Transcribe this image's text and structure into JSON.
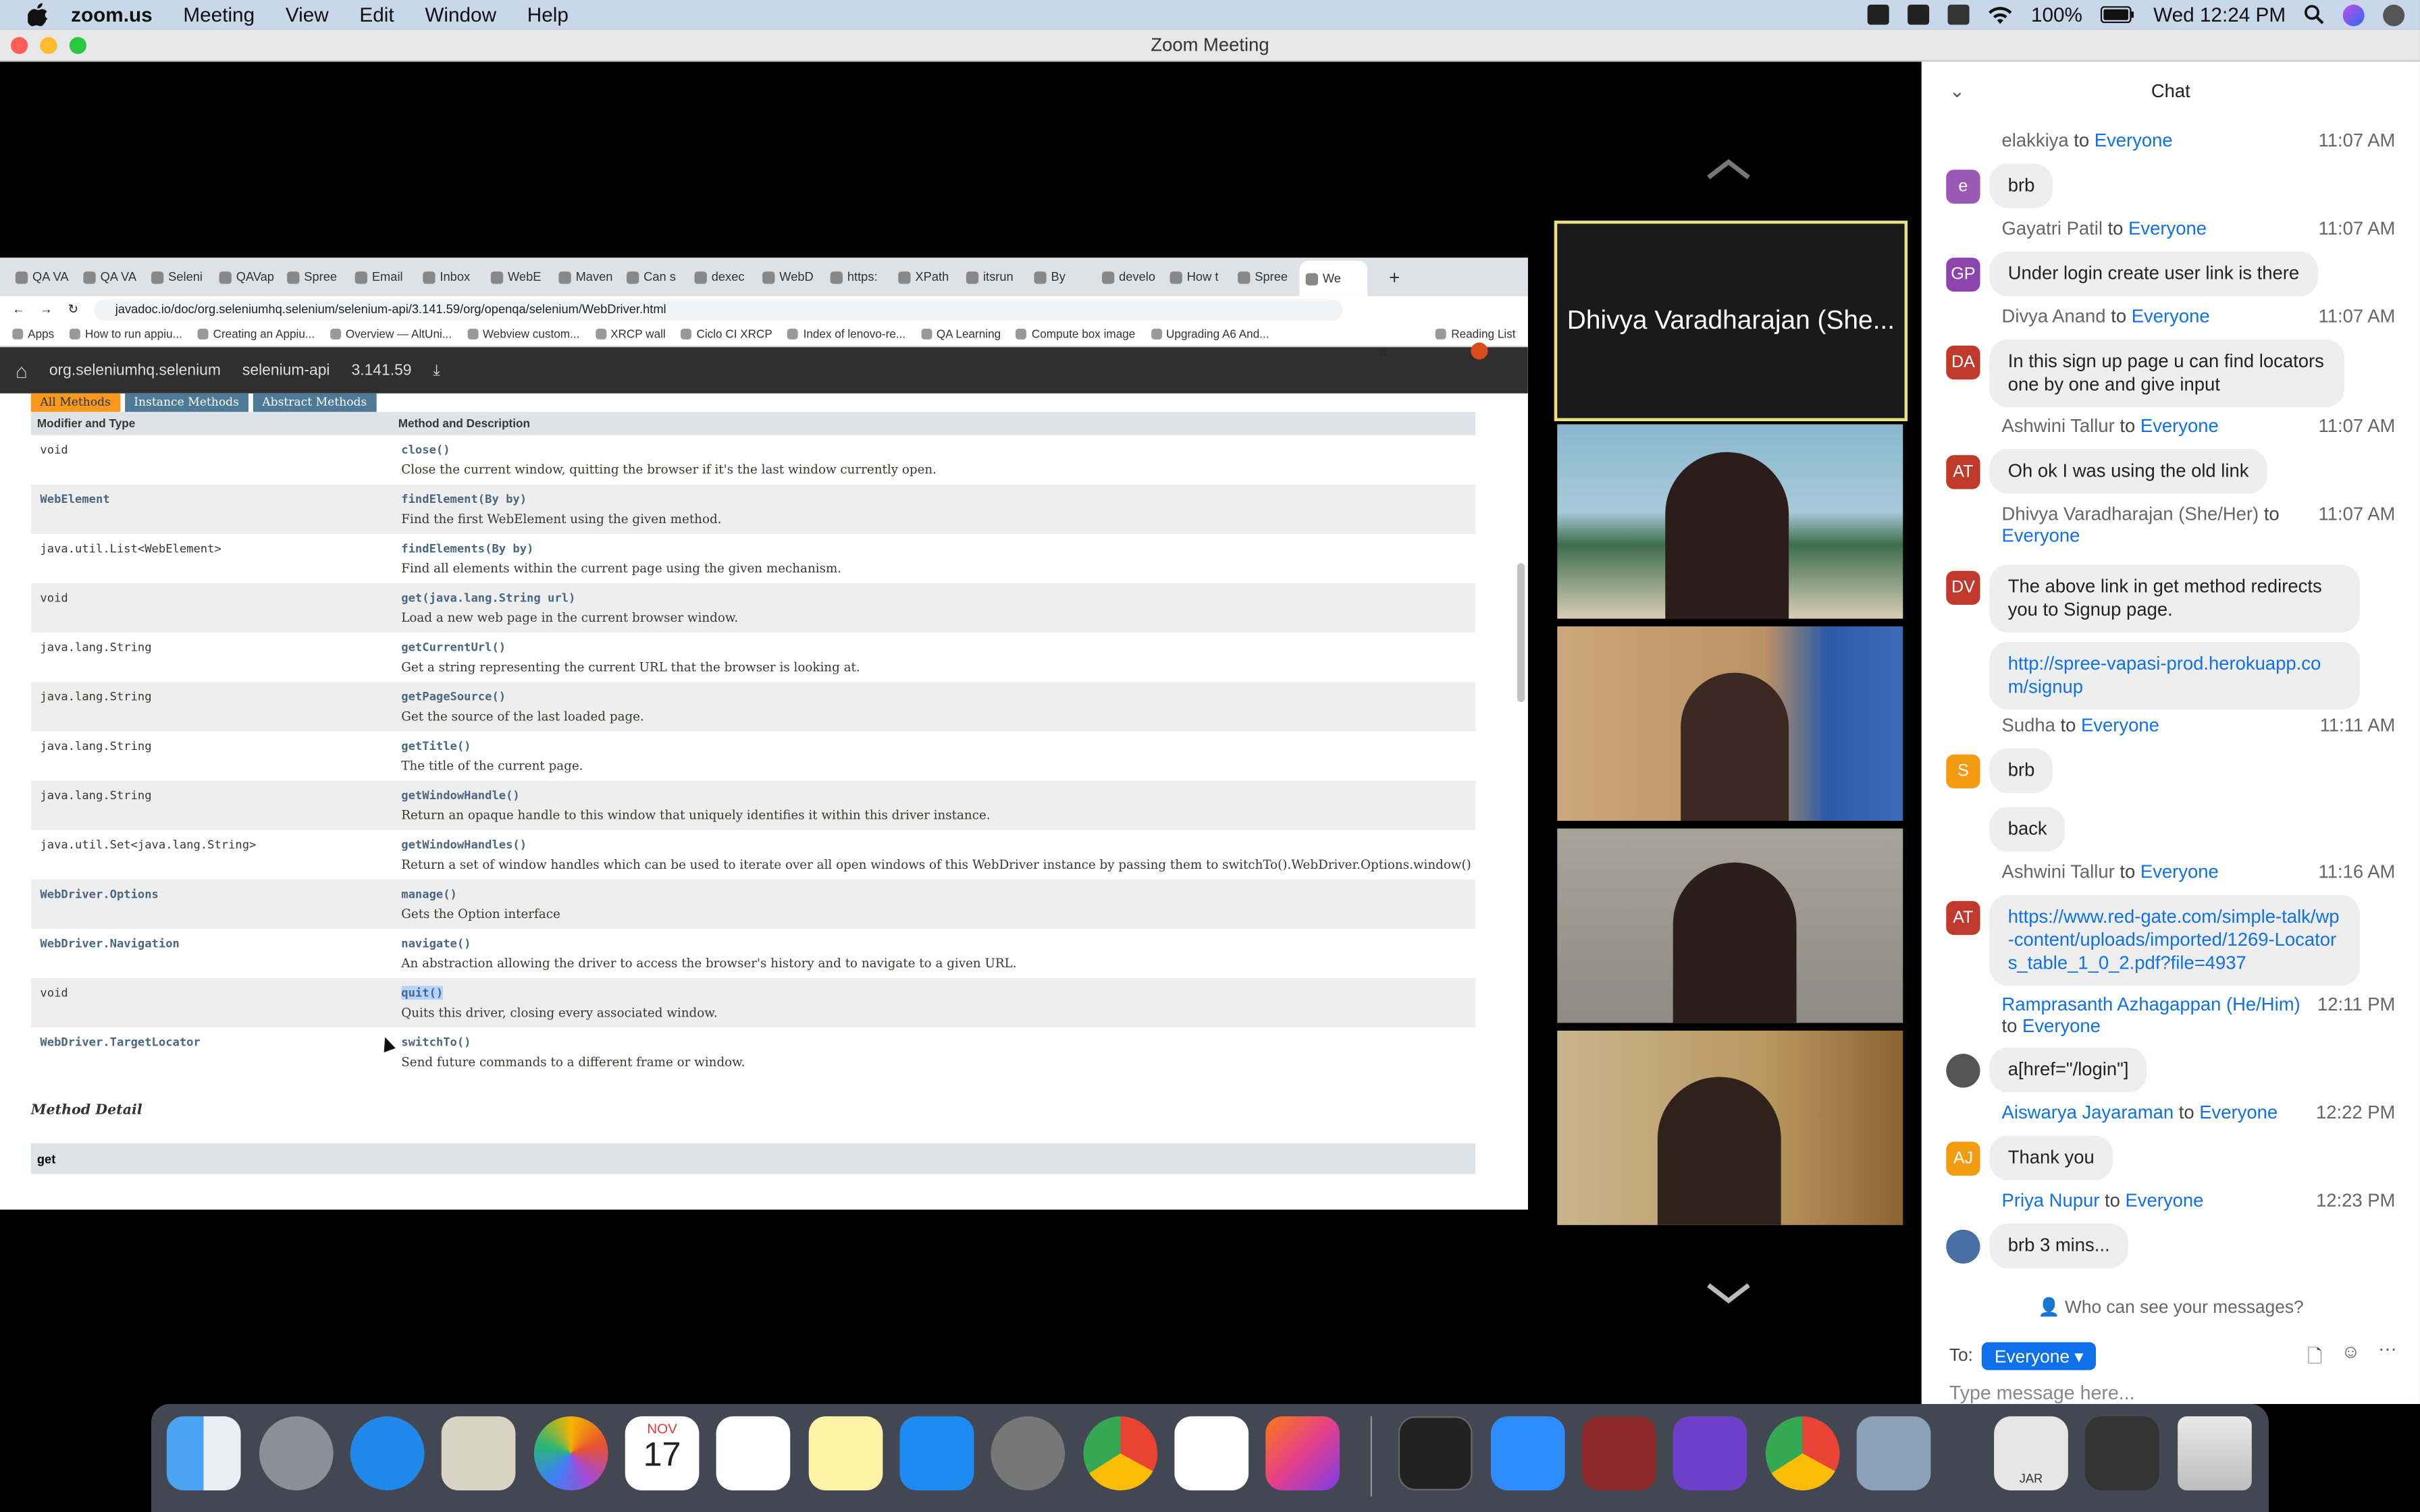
{
  "menubar": {
    "app": "zoom.us",
    "items": [
      "Meeting",
      "View",
      "Edit",
      "Window",
      "Help"
    ],
    "battery": "100%",
    "clock": "Wed 12:24 PM"
  },
  "window": {
    "title": "Zoom Meeting"
  },
  "browser": {
    "tabs": [
      "QA VA",
      "QA VA",
      "Seleni",
      "QAVap",
      "Spree",
      "Email",
      "Inbox",
      "WebE",
      "Maven",
      "Can s",
      "dexec",
      "WebD",
      "https:",
      "XPath",
      "itsrun",
      "By",
      "develo",
      "How t",
      "Spree",
      "We"
    ],
    "url": "javadoc.io/doc/org.seleniumhq.selenium/selenium-api/3.141.59/org/openqa/selenium/WebDriver.html",
    "bookmarks": [
      "Apps",
      "How to run appiu...",
      "Creating an Appiu...",
      "Overview — AltUni...",
      "Webview custom...",
      "XRCP wall",
      "Ciclo CI XRCP",
      "Index of lenovo-re...",
      "QA Learning",
      "Compute box image",
      "Upgrading A6 And...",
      "Reading List"
    ],
    "docnav": {
      "group": "org.seleniumhq.selenium",
      "artifact": "selenium-api",
      "version": "3.141.59"
    },
    "method_tabs": [
      "All Methods",
      "Instance Methods",
      "Abstract Methods"
    ],
    "table_headers": [
      "Modifier and Type",
      "Method and Description"
    ],
    "rows": [
      {
        "type": "void",
        "method": "close()",
        "desc": "Close the current window, quitting the browser if it's the last window currently open."
      },
      {
        "type": "WebElement",
        "method": "findElement(By by)",
        "desc": "Find the first WebElement using the given method."
      },
      {
        "type": "java.util.List<WebElement>",
        "method": "findElements(By by)",
        "desc": "Find all elements within the current page using the given mechanism."
      },
      {
        "type": "void",
        "method": "get(java.lang.String url)",
        "desc": "Load a new web page in the current browser window."
      },
      {
        "type": "java.lang.String",
        "method": "getCurrentUrl()",
        "desc": "Get a string representing the current URL that the browser is looking at."
      },
      {
        "type": "java.lang.String",
        "method": "getPageSource()",
        "desc": "Get the source of the last loaded page."
      },
      {
        "type": "java.lang.String",
        "method": "getTitle()",
        "desc": "The title of the current page."
      },
      {
        "type": "java.lang.String",
        "method": "getWindowHandle()",
        "desc": "Return an opaque handle to this window that uniquely identifies it within this driver instance."
      },
      {
        "type": "java.util.Set<java.lang.String>",
        "method": "getWindowHandles()",
        "desc": "Return a set of window handles which can be used to iterate over all open windows of this WebDriver instance by passing them to switchTo().WebDriver.Options.window()"
      },
      {
        "type": "WebDriver.Options",
        "method": "manage()",
        "desc": "Gets the Option interface"
      },
      {
        "type": "WebDriver.Navigation",
        "method": "navigate()",
        "desc": "An abstraction allowing the driver to access the browser's history and to navigate to a given URL."
      },
      {
        "type": "void",
        "method": "quit()",
        "desc": "Quits this driver, closing every associated window."
      },
      {
        "type": "WebDriver.TargetLocator",
        "method": "switchTo()",
        "desc": "Send future commands to a different frame or window."
      }
    ],
    "method_detail": "Method Detail",
    "get_label": "get"
  },
  "video": {
    "active_speaker": "Dhivya Varadharajan (She..."
  },
  "chat": {
    "title": "Chat",
    "messages": [
      {
        "sender": "elakkiya",
        "to": "Everyone",
        "time": "11:07 AM",
        "avatar": "e",
        "color": "#9b59b6",
        "texts": [
          "brb"
        ]
      },
      {
        "sender": "Gayatri Patil",
        "to": "Everyone",
        "time": "11:07 AM",
        "avatar": "GP",
        "color": "#8e44ad",
        "texts": [
          "Under login create user link is there"
        ]
      },
      {
        "sender": "Divya Anand",
        "to": "Everyone",
        "time": "11:07 AM",
        "avatar": "DA",
        "color": "#c0392b",
        "texts": [
          "In this sign up page u can find locators one by one and give input"
        ]
      },
      {
        "sender": "Ashwini Tallur",
        "to": "Everyone",
        "time": "11:07 AM",
        "avatar": "AT",
        "color": "#c0392b",
        "texts": [
          "Oh ok I was using the old link"
        ]
      },
      {
        "sender": "Dhivya Varadharajan (She/Her)",
        "to": "Everyone",
        "time": "11:07 AM",
        "avatar": "DV",
        "color": "#c0392b",
        "texts": [
          "The above link in get method redirects you to Signup page.",
          "http://spree-vapasi-prod.herokuapp.com/signup"
        ]
      },
      {
        "sender": "Sudha",
        "to": "Everyone",
        "time": "11:11 AM",
        "avatar": "S",
        "color": "#f39c12",
        "texts": [
          "brb",
          "back"
        ]
      },
      {
        "sender": "Ashwini Tallur",
        "to": "Everyone",
        "time": "11:16 AM",
        "avatar": "AT",
        "color": "#c0392b",
        "texts": [
          "https://www.red-gate.com/simple-talk/wp-content/uploads/imported/1269-Locators_table_1_0_2.pdf?file=4937"
        ]
      },
      {
        "sender": "Ramprasanth Azhagappan (He/Him)",
        "to": "Everyone",
        "time": "12:11 PM",
        "avatar": "",
        "color": "#555",
        "texts": [
          "a[href=\"/login\"]"
        ]
      },
      {
        "sender": "Aiswarya Jayaraman",
        "to": "Everyone",
        "time": "12:22 PM",
        "avatar": "AJ",
        "color": "#f39c12",
        "texts": [
          "Thank you"
        ]
      },
      {
        "sender": "Priya Nupur",
        "to": "Everyone",
        "time": "12:23 PM",
        "avatar": "",
        "color": "#4a6fa5",
        "texts": [
          "brb 3 mins..."
        ]
      }
    ],
    "who_can_see": "Who can see your messages?",
    "to_label": "To:",
    "to_value": "Everyone",
    "input_placeholder": "Type message here..."
  },
  "dock": {
    "calendar_month": "NOV",
    "calendar_day": "17",
    "jar_label": "JAR"
  }
}
